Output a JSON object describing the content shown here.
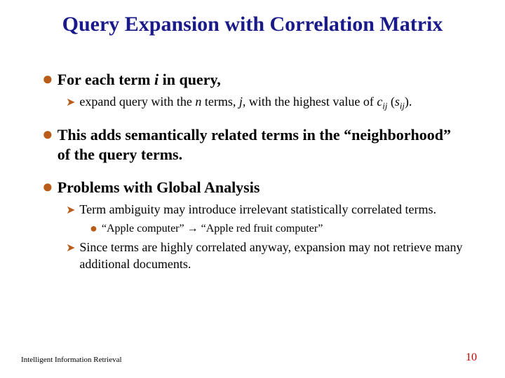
{
  "title": "Query Expansion with Correlation Matrix",
  "b1": {
    "text_a": "For each term ",
    "text_i": "i",
    "text_b": " in query,"
  },
  "b1s1": {
    "a": "expand query with the ",
    "n": "n",
    "b": " terms, ",
    "j": "j",
    "c": ", with the highest value of ",
    "cv": "c",
    "ij1": "ij",
    "d": " (",
    "sv": "s",
    "ij2": "ij",
    "e": ")."
  },
  "b2": "This adds semantically related terms in the “neighborhood” of the query terms.",
  "b3": "Problems with Global Analysis",
  "b3s1": "Term ambiguity may introduce irrelevant statistically correlated terms.",
  "b3s1a": "“Apple computer” → “Apple red fruit computer”",
  "b3s2": "Since terms are highly correlated anyway, expansion may not retrieve many additional documents.",
  "footer_left": "Intelligent Information Retrieval",
  "footer_right": "10"
}
